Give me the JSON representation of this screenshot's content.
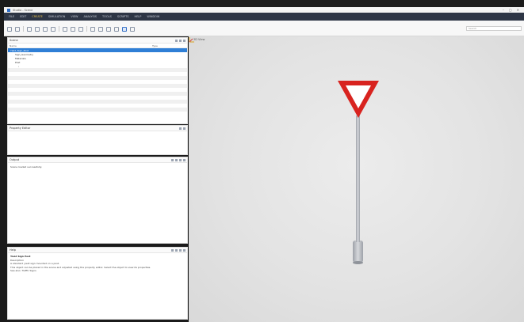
{
  "window": {
    "title": "Studio - Scene",
    "controls": [
      "–",
      "▢",
      "✕"
    ]
  },
  "menu": {
    "items": [
      "FILE",
      "EDIT",
      "CREATE",
      "SIMULATION",
      "VIEW",
      "ANALYSIS",
      "TOOLS",
      "SCRIPTS",
      "HELP",
      "WINDOW"
    ],
    "active_index": 2
  },
  "toolbar": {
    "search_placeholder": "Search"
  },
  "scene": {
    "title": "Scene",
    "columns": [
      "Name",
      "Type"
    ],
    "rows": [
      {
        "label": "Yield_Sign_Post",
        "level": 0,
        "selected": true
      },
      {
        "label": "Sign_Geometry",
        "level": 1,
        "selected": false
      },
      {
        "label": "Materials",
        "level": 1,
        "selected": false
      },
      {
        "label": "Post",
        "level": 1,
        "selected": false
      },
      {
        "label": "›",
        "level": 2,
        "selected": false
      }
    ]
  },
  "properties": {
    "title": "Property Editor"
  },
  "output": {
    "title": "Output",
    "message": "Scene loaded successfully."
  },
  "help": {
    "title": "Help",
    "heading": "Yield Sign Post",
    "lines": [
      "Description",
      "A standard yield sign mounted on a post.",
      "This object can be placed in the scene and adjusted using the property editor. Select the object to view its properties.",
      "See also: Traffic Signs"
    ]
  },
  "viewport": {
    "label": "3D View"
  },
  "colors": {
    "menubar": "#2d3545",
    "selection": "#2f7fd6",
    "sign_red": "#d8231f",
    "sign_white": "#ffffff",
    "post": "#b9bcc2"
  }
}
